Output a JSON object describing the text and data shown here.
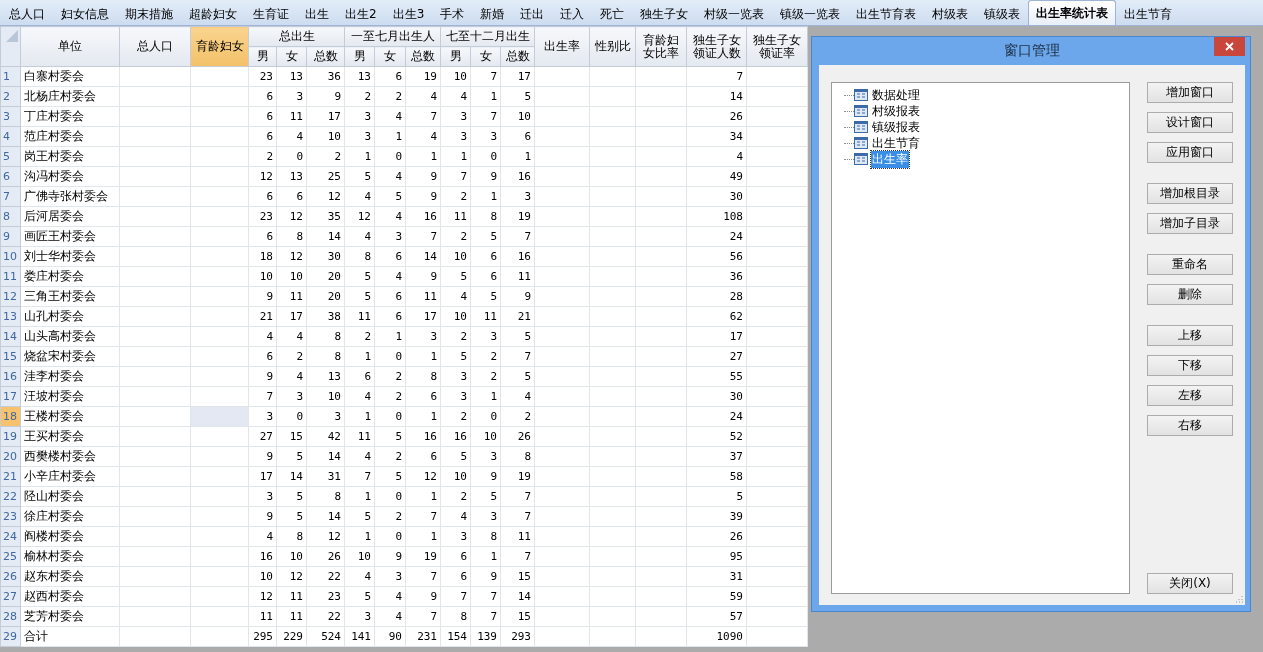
{
  "tabs": [
    {
      "label": "总人口",
      "selected": false
    },
    {
      "label": "妇女信息",
      "selected": false
    },
    {
      "label": "期末措施",
      "selected": false
    },
    {
      "label": "超龄妇女",
      "selected": false
    },
    {
      "label": "生育证",
      "selected": false
    },
    {
      "label": "出生",
      "selected": false
    },
    {
      "label": "出生2",
      "selected": false
    },
    {
      "label": "出生3",
      "selected": false
    },
    {
      "label": "手术",
      "selected": false
    },
    {
      "label": "新婚",
      "selected": false
    },
    {
      "label": "迁出",
      "selected": false
    },
    {
      "label": "迁入",
      "selected": false
    },
    {
      "label": "死亡",
      "selected": false
    },
    {
      "label": "独生子女",
      "selected": false
    },
    {
      "label": "村级一览表",
      "selected": false
    },
    {
      "label": "镇级一览表",
      "selected": false
    },
    {
      "label": "出生节育表",
      "selected": false
    },
    {
      "label": "村级表",
      "selected": false
    },
    {
      "label": "镇级表",
      "selected": false
    },
    {
      "label": "出生率统计表",
      "selected": true
    },
    {
      "label": "出生节育",
      "selected": false
    }
  ],
  "table": {
    "columns": [
      {
        "label": "单位",
        "selected": false
      },
      {
        "label": "总人口",
        "selected": false
      },
      {
        "label": "育龄妇女",
        "selected": true
      },
      {
        "label": "总出生",
        "selected": false,
        "children": [
          "男",
          "女",
          "总数"
        ]
      },
      {
        "label": "一至七月出生人",
        "selected": false,
        "children": [
          "男",
          "女",
          "总数"
        ]
      },
      {
        "label": "七至十二月出生",
        "selected": false,
        "children": [
          "男",
          "女",
          "总数"
        ]
      },
      {
        "label": "出生率",
        "selected": false
      },
      {
        "label": "性别比",
        "selected": false
      },
      {
        "label": "育龄妇女比率",
        "selected": false
      },
      {
        "label": "独生子女领证人数",
        "selected": false
      },
      {
        "label": "独生子女领证率",
        "selected": false
      }
    ],
    "rows": [
      {
        "number": "1",
        "unit": "白寨村委会",
        "births": [
          "23",
          "13",
          "36",
          "13",
          "6",
          "19",
          "10",
          "7",
          "17"
        ],
        "certified": "7",
        "selected": false
      },
      {
        "number": "2",
        "unit": "北杨庄村委会",
        "births": [
          "6",
          "3",
          "9",
          "2",
          "2",
          "4",
          "4",
          "1",
          "5"
        ],
        "certified": "14",
        "selected": false
      },
      {
        "number": "3",
        "unit": "丁庄村委会",
        "births": [
          "6",
          "11",
          "17",
          "3",
          "4",
          "7",
          "3",
          "7",
          "10"
        ],
        "certified": "26",
        "selected": false
      },
      {
        "number": "4",
        "unit": "范庄村委会",
        "births": [
          "6",
          "4",
          "10",
          "3",
          "1",
          "4",
          "3",
          "3",
          "6"
        ],
        "certified": "34",
        "selected": false
      },
      {
        "number": "5",
        "unit": "岗王村委会",
        "births": [
          "2",
          "0",
          "2",
          "1",
          "0",
          "1",
          "1",
          "0",
          "1"
        ],
        "certified": "4",
        "selected": false
      },
      {
        "number": "6",
        "unit": "沟冯村委会",
        "births": [
          "12",
          "13",
          "25",
          "5",
          "4",
          "9",
          "7",
          "9",
          "16"
        ],
        "certified": "49",
        "selected": false
      },
      {
        "number": "7",
        "unit": "广佛寺张村委会",
        "births": [
          "6",
          "6",
          "12",
          "4",
          "5",
          "9",
          "2",
          "1",
          "3"
        ],
        "certified": "30",
        "selected": false
      },
      {
        "number": "8",
        "unit": "后河居委会",
        "births": [
          "23",
          "12",
          "35",
          "12",
          "4",
          "16",
          "11",
          "8",
          "19"
        ],
        "certified": "108",
        "selected": false
      },
      {
        "number": "9",
        "unit": "画匠王村委会",
        "births": [
          "6",
          "8",
          "14",
          "4",
          "3",
          "7",
          "2",
          "5",
          "7"
        ],
        "certified": "24",
        "selected": false
      },
      {
        "number": "10",
        "unit": "刘士华村委会",
        "births": [
          "18",
          "12",
          "30",
          "8",
          "6",
          "14",
          "10",
          "6",
          "16"
        ],
        "certified": "56",
        "selected": false
      },
      {
        "number": "11",
        "unit": "娄庄村委会",
        "births": [
          "10",
          "10",
          "20",
          "5",
          "4",
          "9",
          "5",
          "6",
          "11"
        ],
        "certified": "36",
        "selected": false
      },
      {
        "number": "12",
        "unit": "三角王村委会",
        "births": [
          "9",
          "11",
          "20",
          "5",
          "6",
          "11",
          "4",
          "5",
          "9"
        ],
        "certified": "28",
        "selected": false
      },
      {
        "number": "13",
        "unit": "山孔村委会",
        "births": [
          "21",
          "17",
          "38",
          "11",
          "6",
          "17",
          "10",
          "11",
          "21"
        ],
        "certified": "62",
        "selected": false
      },
      {
        "number": "14",
        "unit": "山头高村委会",
        "births": [
          "4",
          "4",
          "8",
          "2",
          "1",
          "3",
          "2",
          "3",
          "5"
        ],
        "certified": "17",
        "selected": false
      },
      {
        "number": "15",
        "unit": "烧盆宋村委会",
        "births": [
          "6",
          "2",
          "8",
          "1",
          "0",
          "1",
          "5",
          "2",
          "7"
        ],
        "certified": "27",
        "selected": false
      },
      {
        "number": "16",
        "unit": "洼李村委会",
        "births": [
          "9",
          "4",
          "13",
          "6",
          "2",
          "8",
          "3",
          "2",
          "5"
        ],
        "certified": "55",
        "selected": false
      },
      {
        "number": "17",
        "unit": "汪坡村委会",
        "births": [
          "7",
          "3",
          "10",
          "4",
          "2",
          "6",
          "3",
          "1",
          "4"
        ],
        "certified": "30",
        "selected": false
      },
      {
        "number": "18",
        "unit": "王楼村委会",
        "births": [
          "3",
          "0",
          "3",
          "1",
          "0",
          "1",
          "2",
          "0",
          "2"
        ],
        "certified": "24",
        "selected": true
      },
      {
        "number": "19",
        "unit": "王买村委会",
        "births": [
          "27",
          "15",
          "42",
          "11",
          "5",
          "16",
          "16",
          "10",
          "26"
        ],
        "certified": "52",
        "selected": false
      },
      {
        "number": "20",
        "unit": "西樊楼村委会",
        "births": [
          "9",
          "5",
          "14",
          "4",
          "2",
          "6",
          "5",
          "3",
          "8"
        ],
        "certified": "37",
        "selected": false
      },
      {
        "number": "21",
        "unit": "小辛庄村委会",
        "births": [
          "17",
          "14",
          "31",
          "7",
          "5",
          "12",
          "10",
          "9",
          "19"
        ],
        "certified": "58",
        "selected": false
      },
      {
        "number": "22",
        "unit": "陉山村委会",
        "births": [
          "3",
          "5",
          "8",
          "1",
          "0",
          "1",
          "2",
          "5",
          "7"
        ],
        "certified": "5",
        "selected": false
      },
      {
        "number": "23",
        "unit": "徐庄村委会",
        "births": [
          "9",
          "5",
          "14",
          "5",
          "2",
          "7",
          "4",
          "3",
          "7"
        ],
        "certified": "39",
        "selected": false
      },
      {
        "number": "24",
        "unit": "阎楼村委会",
        "births": [
          "4",
          "8",
          "12",
          "1",
          "0",
          "1",
          "3",
          "8",
          "11"
        ],
        "certified": "26",
        "selected": false
      },
      {
        "number": "25",
        "unit": "榆林村委会",
        "births": [
          "16",
          "10",
          "26",
          "10",
          "9",
          "19",
          "6",
          "1",
          "7"
        ],
        "certified": "95",
        "selected": false
      },
      {
        "number": "26",
        "unit": "赵东村委会",
        "births": [
          "10",
          "12",
          "22",
          "4",
          "3",
          "7",
          "6",
          "9",
          "15"
        ],
        "certified": "31",
        "selected": false
      },
      {
        "number": "27",
        "unit": "赵西村委会",
        "births": [
          "12",
          "11",
          "23",
          "5",
          "4",
          "9",
          "7",
          "7",
          "14"
        ],
        "certified": "59",
        "selected": false
      },
      {
        "number": "28",
        "unit": "芝芳村委会",
        "births": [
          "11",
          "11",
          "22",
          "3",
          "4",
          "7",
          "8",
          "7",
          "15"
        ],
        "certified": "57",
        "selected": false
      },
      {
        "number": "29",
        "unit": "合计",
        "births": [
          "295",
          "229",
          "524",
          "141",
          "90",
          "231",
          "154",
          "139",
          "293"
        ],
        "certified": "1090",
        "selected": false
      }
    ]
  },
  "dialog": {
    "title": "窗口管理",
    "tree": [
      {
        "label": "数据处理",
        "selected": false
      },
      {
        "label": "村级报表",
        "selected": false
      },
      {
        "label": "镇级报表",
        "selected": false
      },
      {
        "label": "出生节育",
        "selected": false
      },
      {
        "label": "出生率",
        "selected": true
      }
    ],
    "button_groups": [
      [
        "增加窗口",
        "设计窗口",
        "应用窗口"
      ],
      [
        "增加根目录",
        "增加子目录"
      ],
      [
        "重命名",
        "删除"
      ],
      [
        "上移",
        "下移",
        "左移",
        "右移"
      ]
    ],
    "close_button": "关闭(X)"
  }
}
